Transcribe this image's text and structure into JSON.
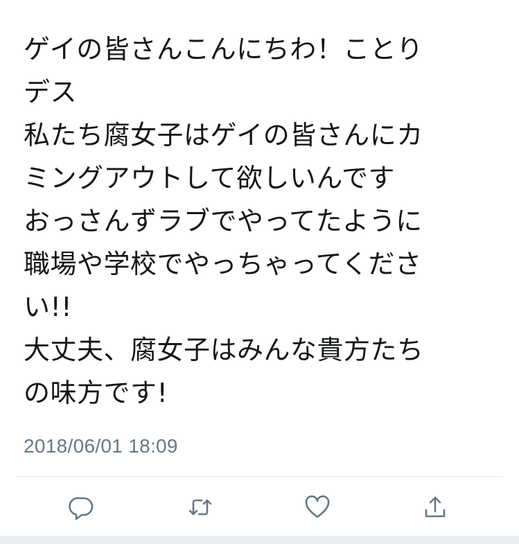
{
  "tweet": {
    "lines": [
      "ゲイの皆さんこんにちわ！ことり",
      "デス",
      "私たち腐女子はゲイの皆さんにカ",
      "ミングアウトして欲しいんです",
      "おっさんずラブでやってたように",
      "職場や学校でやっちゃってくださ",
      "い!!",
      "大丈夫、腐女子はみんな貴方たち",
      "の味方です!"
    ],
    "timestamp": "2018/06/01 18:09"
  },
  "actions": {
    "reply_icon": "reply-icon",
    "retweet_icon": "retweet-icon",
    "like_icon": "heart-icon",
    "share_icon": "share-icon"
  },
  "colors": {
    "text": "#14171a",
    "meta": "#657786",
    "icon": "#657786",
    "divider": "#e1e8ed"
  }
}
